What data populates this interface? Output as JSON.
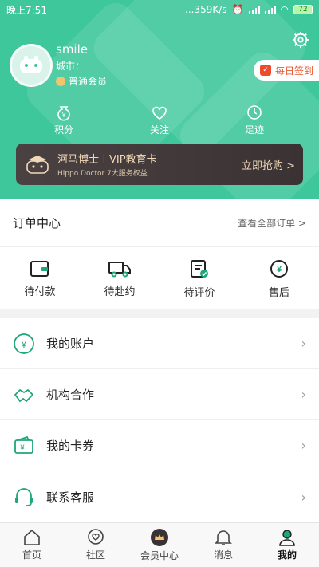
{
  "status_bar": {
    "time": "晚上7:51",
    "speed": "...359K/s",
    "battery": "72"
  },
  "profile": {
    "name": "smile",
    "city": "城市：",
    "member_level": "普通会员"
  },
  "checkin": {
    "label": "每日签到"
  },
  "stats": [
    {
      "label": "积分"
    },
    {
      "label": "关注"
    },
    {
      "label": "足迹"
    }
  ],
  "vip": {
    "title": "河马博士丨VIP教育卡",
    "subtitle": "Hippo Doctor 7大服务权益",
    "cta": "立即抢购 >"
  },
  "orders": {
    "title": "订单中心",
    "view_all": "查看全部订单 >",
    "items": [
      {
        "label": "待付款"
      },
      {
        "label": "待赴约"
      },
      {
        "label": "待评价"
      },
      {
        "label": "售后"
      }
    ]
  },
  "menu": [
    {
      "label": "我的账户"
    },
    {
      "label": "机构合作"
    },
    {
      "label": "我的卡券"
    },
    {
      "label": "联系客服"
    }
  ],
  "tabbar": [
    {
      "label": "首页"
    },
    {
      "label": "社区"
    },
    {
      "label": "会员中心"
    },
    {
      "label": "消息"
    },
    {
      "label": "我的"
    }
  ],
  "colors": {
    "primary": "#3ec79b",
    "accent": "#1fa67a",
    "vip_bg": "#3d3536",
    "vip_text": "#f1d8b9",
    "checkin": "#e65a34"
  }
}
